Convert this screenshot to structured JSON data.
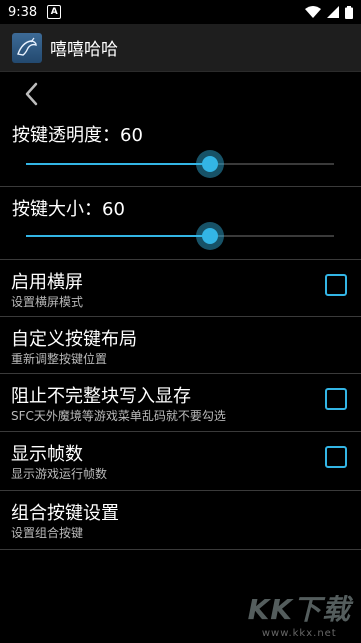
{
  "status_bar": {
    "time": "9:38",
    "notification_letter": "A",
    "icons": [
      "wifi-icon",
      "signal-icon",
      "battery-icon"
    ]
  },
  "action_bar": {
    "title": "嘻嘻哈哈",
    "icon": "mysql-dolphin-icon"
  },
  "back": {
    "icon": "chevron-left-icon"
  },
  "sliders": [
    {
      "label": "按键透明度：60",
      "value": 60,
      "max": 100
    },
    {
      "label": "按键大小：60",
      "value": 60,
      "max": 100
    }
  ],
  "preferences": [
    {
      "title": "启用横屏",
      "summary": "设置横屏模式",
      "checkbox": true,
      "checked": false
    },
    {
      "title": "自定义按键布局",
      "summary": "重新调整按键位置",
      "checkbox": false
    },
    {
      "title": "阻止不完整块写入显存",
      "summary": "SFC天外魔境等游戏菜单乱码就不要勾选",
      "checkbox": true,
      "checked": false
    },
    {
      "title": "显示帧数",
      "summary": "显示游戏运行帧数",
      "checkbox": true,
      "checked": false
    },
    {
      "title": "组合按键设置",
      "summary": "设置组合按键",
      "checkbox": false
    }
  ],
  "watermark": {
    "big": "KK下载",
    "url": "www.kkx.net"
  },
  "colors": {
    "accent": "#33b5e5",
    "background": "#000000",
    "actionbar": "#1e1e1e"
  }
}
